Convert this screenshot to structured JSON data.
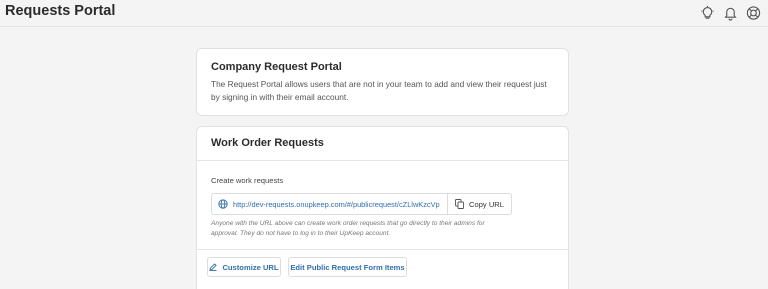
{
  "app": {
    "title": "Requests Portal"
  },
  "header_icons": [
    "lightbulb-icon",
    "bell-icon",
    "help-icon"
  ],
  "intro_card": {
    "title": "Company Request Portal",
    "description": "The Request Portal allows users that are not in your team to add and view their request just by signing in with their email account."
  },
  "work_orders": {
    "title": "Work Order Requests",
    "create_label": "Create work requests",
    "url": "http://dev-requests.onupkeep.com/#/publicrequest/cZLlwKzcVp",
    "copy_label": "Copy URL",
    "help_text": "Anyone with the URL above can create work order requests that go directly to their admins for approval. They do not have to log in to their UpKeep account.",
    "customize_label": "Customize URL",
    "edit_label": "Edit Public Request Form Items"
  },
  "colors": {
    "link": "#2f6fb5",
    "background": "#f4f4f4",
    "card": "#ffffff"
  }
}
